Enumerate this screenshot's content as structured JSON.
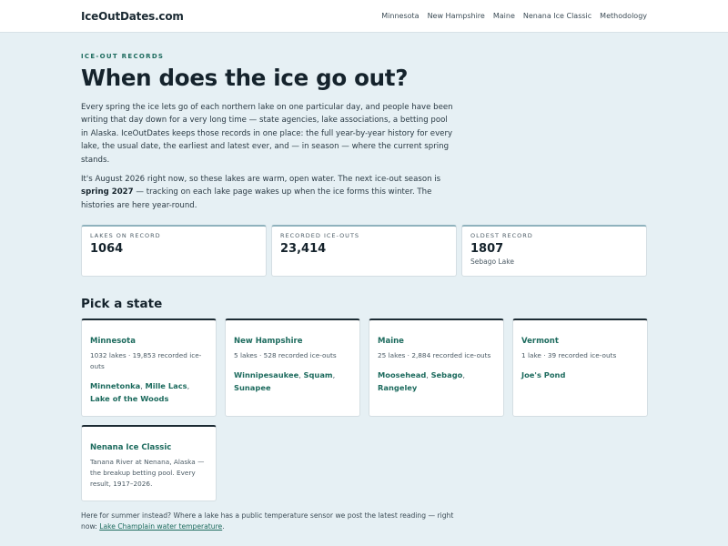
{
  "header": {
    "brand": "IceOutDates.com",
    "nav": [
      "Minnesota",
      "New Hampshire",
      "Maine",
      "Nenana Ice Classic",
      "Methodology"
    ]
  },
  "hero": {
    "eyebrow": "ICE-OUT RECORDS",
    "title": "When does the ice go out?",
    "paragraph1": "Every spring the ice lets go of each northern lake on one particular day, and people have been writing that day down for a very long time — state agencies, lake associations, a betting pool in Alaska. IceOutDates keeps those records in one place: the full year-by-year history for every lake, the usual date, the earliest and latest ever, and — in season — where the current spring stands.",
    "paragraph2_before": "It's August 2026 right now, so these lakes are warm, open water. The next ice-out season is ",
    "paragraph2_strong": "spring 2027",
    "paragraph2_after": " — tracking on each lake page wakes up when the ice forms this winter. The histories are here year-round."
  },
  "stats": [
    {
      "label": "LAKES ON RECORD",
      "value": "1064",
      "sub": ""
    },
    {
      "label": "RECORDED ICE-OUTS",
      "value": "23,414",
      "sub": ""
    },
    {
      "label": "OLDEST RECORD",
      "value": "1807",
      "sub": "Sebago Lake"
    }
  ],
  "states_section": {
    "title": "Pick a state",
    "cards": [
      {
        "name": "Minnesota",
        "meta": "1032 lakes · 19,853 recorded ice-outs",
        "lakes": [
          "Minnetonka",
          "Mille Lacs",
          "Lake of the Woods"
        ]
      },
      {
        "name": "New Hampshire",
        "meta": "5 lakes · 528 recorded ice-outs",
        "lakes": [
          "Winnipesaukee",
          "Squam",
          "Sunapee"
        ]
      },
      {
        "name": "Maine",
        "meta": "25 lakes · 2,884 recorded ice-outs",
        "lakes": [
          "Moosehead",
          "Sebago",
          "Rangeley"
        ]
      },
      {
        "name": "Vermont",
        "meta": "1 lake · 39 recorded ice-outs",
        "lakes": [
          "Joe's Pond"
        ]
      },
      {
        "name": "Nenana Ice Classic",
        "meta": "Tanana River at Nenana, Alaska — the breakup betting pool. Every result, 1917–2026.",
        "lakes": []
      }
    ]
  },
  "footnote": {
    "text": "Here for summer instead? Where a lake has a public temperature sensor we post the latest reading — right now: ",
    "link": "Lake Champlain water temperature",
    "end": "."
  },
  "colors": {
    "accent": "#1d6b5e",
    "background": "#e6f0f4"
  }
}
